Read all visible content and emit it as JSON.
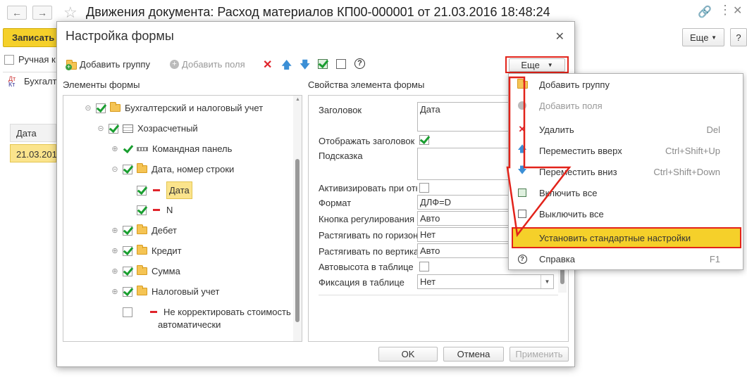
{
  "window": {
    "title": "Движения документа: Расход материалов КП00-000001 от 21.03.2016 18:48:24",
    "save_button": "Записать",
    "manual_label": "Ручная к",
    "tab_label": "Бухгалт",
    "more_button": "Еще",
    "help_button": "?",
    "table_header": "Дата",
    "table_cell": "21.03.201"
  },
  "dialog": {
    "title": "Настройка формы",
    "toolbar": {
      "add_group": "Добавить группу",
      "add_fields": "Добавить поля",
      "more": "Еще"
    },
    "left_header": "Элементы формы",
    "right_header": "Свойства элемента формы",
    "tree": [
      {
        "label": "Бухгалтерский и налоговый учет"
      },
      {
        "label": "Хозрасчетный"
      },
      {
        "label": "Командная панель"
      },
      {
        "label": "Дата, номер строки"
      },
      {
        "label": "Дата"
      },
      {
        "label": "N"
      },
      {
        "label": "Дебет"
      },
      {
        "label": "Кредит"
      },
      {
        "label": "Сумма"
      },
      {
        "label": "Налоговый учет"
      },
      {
        "label": "Не корректировать стоимость"
      },
      {
        "label": "автоматически"
      }
    ],
    "properties": [
      {
        "label": "Заголовок",
        "value": "Дата"
      },
      {
        "label": "Отображать заголовок",
        "value": ""
      },
      {
        "label": "Подсказка",
        "value": ""
      },
      {
        "label": "Активизировать при отк",
        "value": ""
      },
      {
        "label": "Формат",
        "value": "ДЛФ=D"
      },
      {
        "label": "Кнопка регулирования",
        "value": "Авто"
      },
      {
        "label": "Растягивать по горизонт",
        "value": "Нет"
      },
      {
        "label": "Растягивать по вертикал",
        "value": "Авто"
      },
      {
        "label": "Автовысота в таблице",
        "value": ""
      },
      {
        "label": "Фиксация в таблице",
        "value": "Нет"
      }
    ],
    "buttons": {
      "ok": "OK",
      "cancel": "Отмена",
      "apply": "Применить"
    }
  },
  "menu": {
    "items": [
      {
        "label": "Добавить группу",
        "shortcut": "",
        "icon": "add-group-icon"
      },
      {
        "label": "Добавить поля",
        "shortcut": "",
        "icon": "add-fields-icon"
      },
      {
        "label": "Удалить",
        "shortcut": "Del",
        "icon": "delete-icon"
      },
      {
        "label": "Переместить вверх",
        "shortcut": "Ctrl+Shift+Up",
        "icon": "arrow-up-icon"
      },
      {
        "label": "Переместить вниз",
        "shortcut": "Ctrl+Shift+Down",
        "icon": "arrow-down-icon"
      },
      {
        "label": "Включить все",
        "shortcut": "",
        "icon": "check-all-icon"
      },
      {
        "label": "Выключить все",
        "shortcut": "",
        "icon": "uncheck-all-icon"
      },
      {
        "label": "Установить стандартные настройки",
        "shortcut": "",
        "icon": ""
      },
      {
        "label": "Справка",
        "shortcut": "F1",
        "icon": "help-icon"
      }
    ]
  },
  "colors": {
    "accent": "#f5d02a",
    "highlight": "#e2231a",
    "check": "#1a9e30"
  }
}
